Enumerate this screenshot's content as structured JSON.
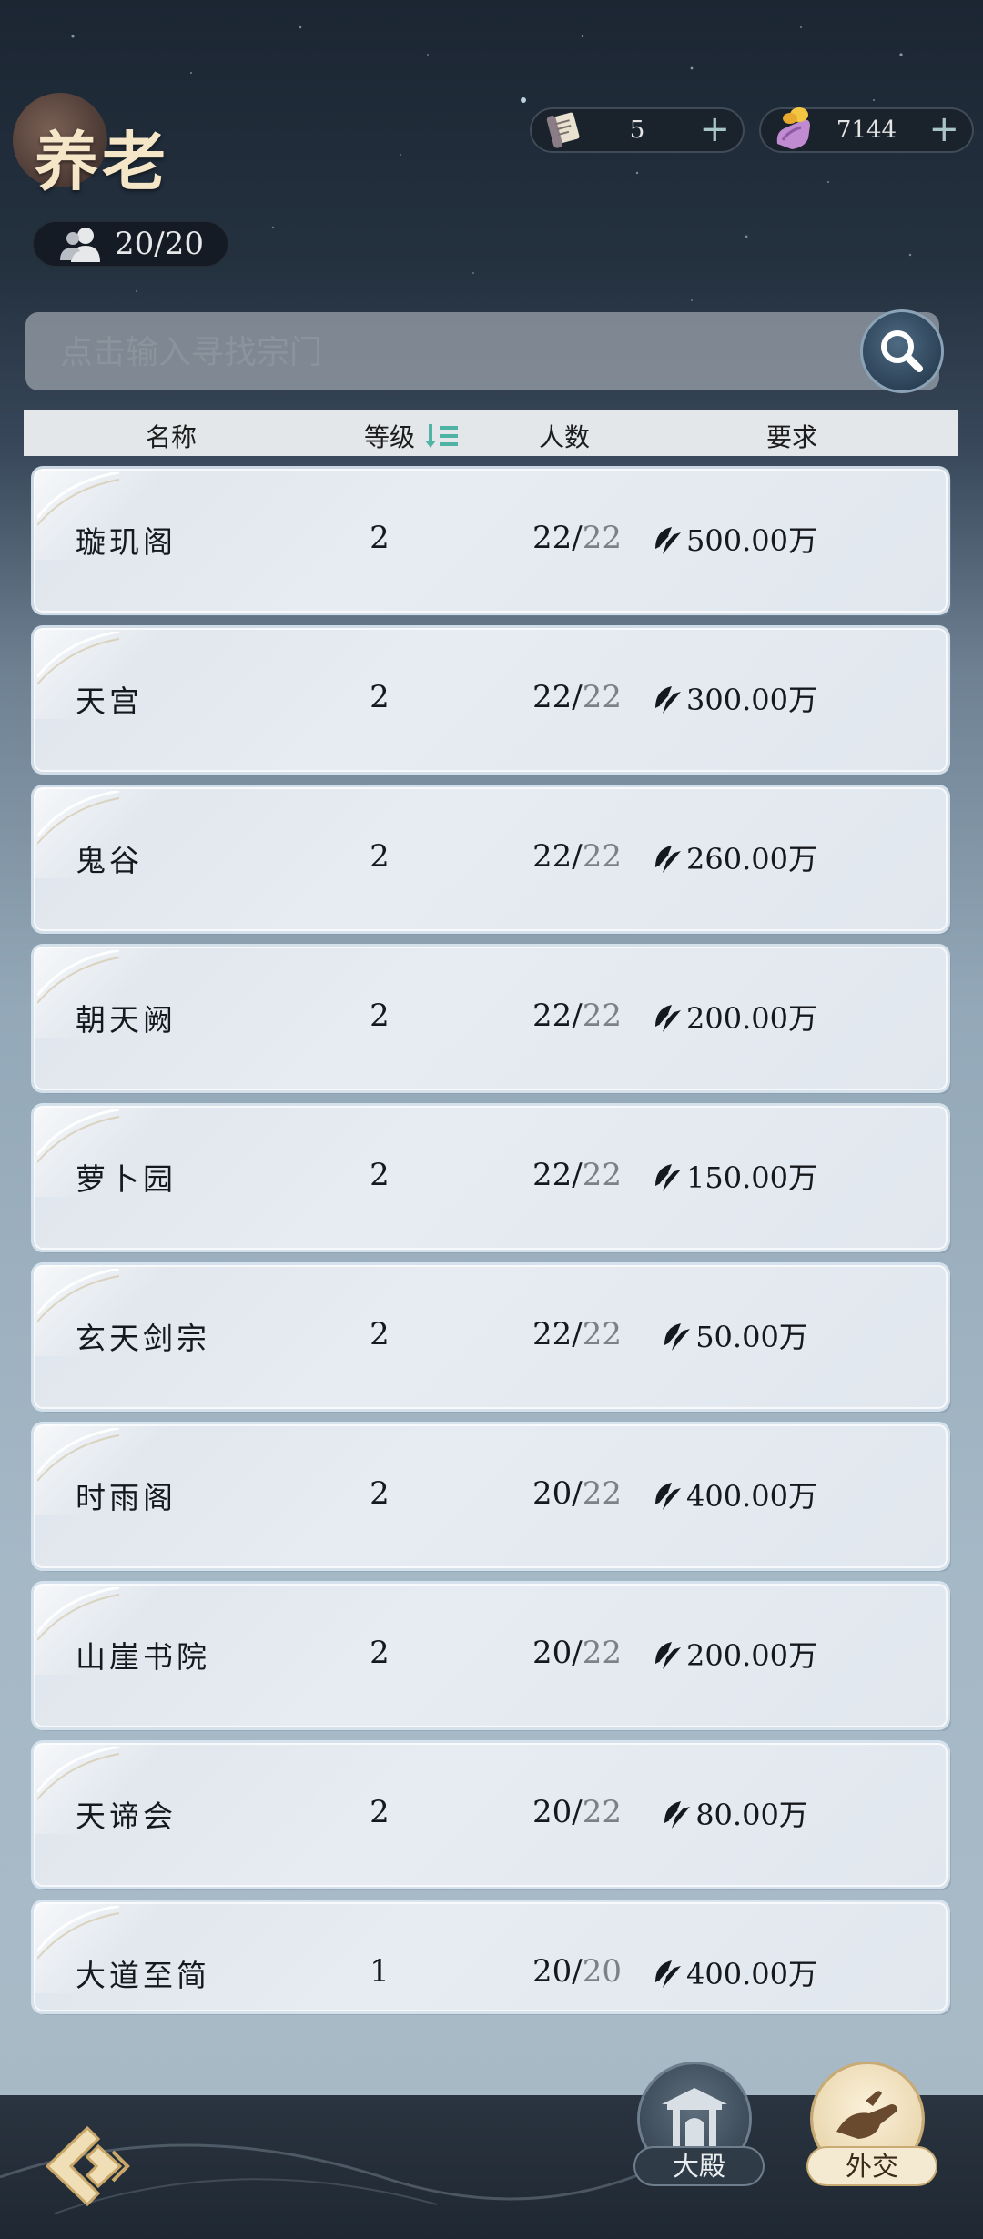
{
  "header": {
    "title": "养老",
    "member_count": "20/20"
  },
  "resources": [
    {
      "icon": "scroll-icon",
      "value": "5",
      "plus": "+"
    },
    {
      "icon": "hand-coin-icon",
      "value": "7144",
      "plus": "+"
    }
  ],
  "search": {
    "placeholder": "点击输入寻找宗门"
  },
  "table": {
    "headers": {
      "name": "名称",
      "level": "等级",
      "count": "人数",
      "requirement": "要求"
    },
    "rows": [
      {
        "name": "璇玑阁",
        "level": "2",
        "current": "22",
        "max": "22",
        "requirement": "500.00万"
      },
      {
        "name": "天宫",
        "level": "2",
        "current": "22",
        "max": "22",
        "requirement": "300.00万"
      },
      {
        "name": "鬼谷",
        "level": "2",
        "current": "22",
        "max": "22",
        "requirement": "260.00万"
      },
      {
        "name": "朝天阙",
        "level": "2",
        "current": "22",
        "max": "22",
        "requirement": "200.00万"
      },
      {
        "name": "萝卜园",
        "level": "2",
        "current": "22",
        "max": "22",
        "requirement": "150.00万"
      },
      {
        "name": "玄天剑宗",
        "level": "2",
        "current": "22",
        "max": "22",
        "requirement": "50.00万"
      },
      {
        "name": "时雨阁",
        "level": "2",
        "current": "20",
        "max": "22",
        "requirement": "400.00万"
      },
      {
        "name": "山崖书院",
        "level": "2",
        "current": "20",
        "max": "22",
        "requirement": "200.00万"
      },
      {
        "name": "天谛会",
        "level": "2",
        "current": "20",
        "max": "22",
        "requirement": "80.00万"
      },
      {
        "name": "大道至简",
        "level": "1",
        "current": "20",
        "max": "20",
        "requirement": "400.00万"
      }
    ]
  },
  "bottom_nav": {
    "hall_label": "大殿",
    "diplomacy_label": "外交"
  },
  "colors": {
    "accent_sort": "#4fb3a6",
    "title_gold": "#f4e6c6"
  }
}
